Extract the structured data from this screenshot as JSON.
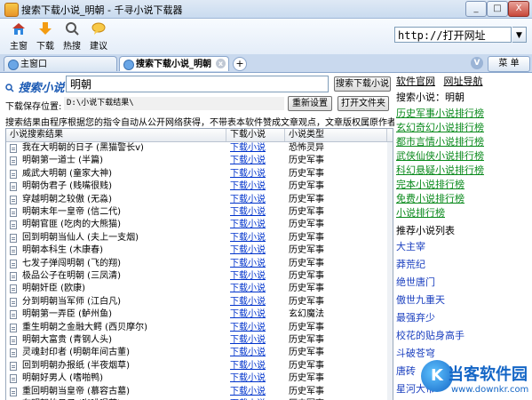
{
  "window": {
    "title": "搜索下载小说_明朝 - 千寻小说下载器",
    "minimize": "_",
    "maximize": "□",
    "close": "X"
  },
  "toolbar": {
    "items": [
      {
        "label": "主窗",
        "icon": "home-icon"
      },
      {
        "label": "下载",
        "icon": "download-icon"
      },
      {
        "label": "热搜",
        "icon": "hot-search-icon"
      },
      {
        "label": "建议",
        "icon": "suggestion-icon"
      }
    ],
    "url_value": "http://打开网址",
    "url_go": "▼"
  },
  "tabs": {
    "items": [
      {
        "label": "主窗口"
      },
      {
        "label": "搜索下载小说_明朝"
      }
    ],
    "add": "+",
    "v": "V",
    "menu": "菜 单"
  },
  "search": {
    "label": "搜索小说",
    "query": "明朝",
    "search_button": "搜索下载小说",
    "path_label": "下载保存位置:",
    "path_value": "D:\\小说下载结果\\",
    "reset_button": "重新设置",
    "open_folder_button": "打开文件夹",
    "notice": "搜索结果由程序根据您的指令自动从公开网络获得，不带表本软件赞成文章观点，文章版权属原作者，若有疑问请"
  },
  "table": {
    "headers": [
      "小说搜索结果",
      "下载小说",
      "小说类型"
    ],
    "link_label": "下载小说",
    "rows": [
      {
        "title": "我在大明朝的日子 (黑猫警长v)",
        "type": "恐怖灵异"
      },
      {
        "title": "明朝第一道士 (半篇)",
        "type": "历史军事"
      },
      {
        "title": "威武大明朝 (童家大神)",
        "type": "历史军事"
      },
      {
        "title": "明朝伪君子 (贱嘴很贱)",
        "type": "历史军事"
      },
      {
        "title": "穿越明朝之较傲 (无淼)",
        "type": "历史军事"
      },
      {
        "title": "明朝末年一皇帝 (信二代)",
        "type": "历史军事"
      },
      {
        "title": "明朝官匪 (吃肉的大熊猫)",
        "type": "历史军事"
      },
      {
        "title": "回到明朝当仙人 (夫上一支烟)",
        "type": "历史军事"
      },
      {
        "title": "明朝本科生 (木康春)",
        "type": "历史军事"
      },
      {
        "title": "七发子弹闯明朝 (飞的翔)",
        "type": "历史军事"
      },
      {
        "title": "极品公子在明朝 (三凤清)",
        "type": "历史军事"
      },
      {
        "title": "明朝奸臣 (欧康)",
        "type": "历史军事"
      },
      {
        "title": "分到明朝当军师 (江白凡)",
        "type": "历史军事"
      },
      {
        "title": "明朝第一弄臣 (鲈州鱼)",
        "type": "玄幻魔法"
      },
      {
        "title": "重生明朝之金融大鳄 (西贝摩尔)",
        "type": "历史军事"
      },
      {
        "title": "明朝大富贵 (青钢人头)",
        "type": "历史军事"
      },
      {
        "title": "灵魂封印者 (明朝年间古董)",
        "type": "历史军事"
      },
      {
        "title": "回到明朝办报纸 (半夜烟草)",
        "type": "历史军事"
      },
      {
        "title": "明朝好男人 (嗜啪鸭)",
        "type": "历史军事"
      },
      {
        "title": "重回明朝当皇帝 (慕容古墓)",
        "type": "历史军事"
      },
      {
        "title": "在明朝的日子 (咖啡喝茶)",
        "type": "历史军事"
      }
    ]
  },
  "sidebar": {
    "links": [
      "软件官网",
      "网址导航"
    ],
    "search_status": "搜索小说：明朝",
    "ranks": [
      "历史军事小说排行榜",
      "玄幻奇幻小说排行榜",
      "都市言情小说排行榜",
      "武侠仙侠小说排行榜",
      "科幻悬疑小说排行榜",
      "完本小说排行榜",
      "免费小说排行榜",
      "小说排行榜"
    ],
    "recommend_title": "推荐小说列表",
    "recommend": [
      "大主宰",
      "莽荒纪",
      "绝世唐门",
      "傲世九重天",
      "最强弃少",
      "校花的贴身高手",
      "斗破苍穹",
      "唐砖",
      "星河大帝"
    ]
  },
  "watermark": {
    "name": "当客软件园",
    "url": "www.downkr.com",
    "logo_char": "K"
  },
  "colors": {
    "rank_green": "#0a8a1c",
    "link_blue": "#0033cc",
    "brand_blue": "#1466c6"
  }
}
